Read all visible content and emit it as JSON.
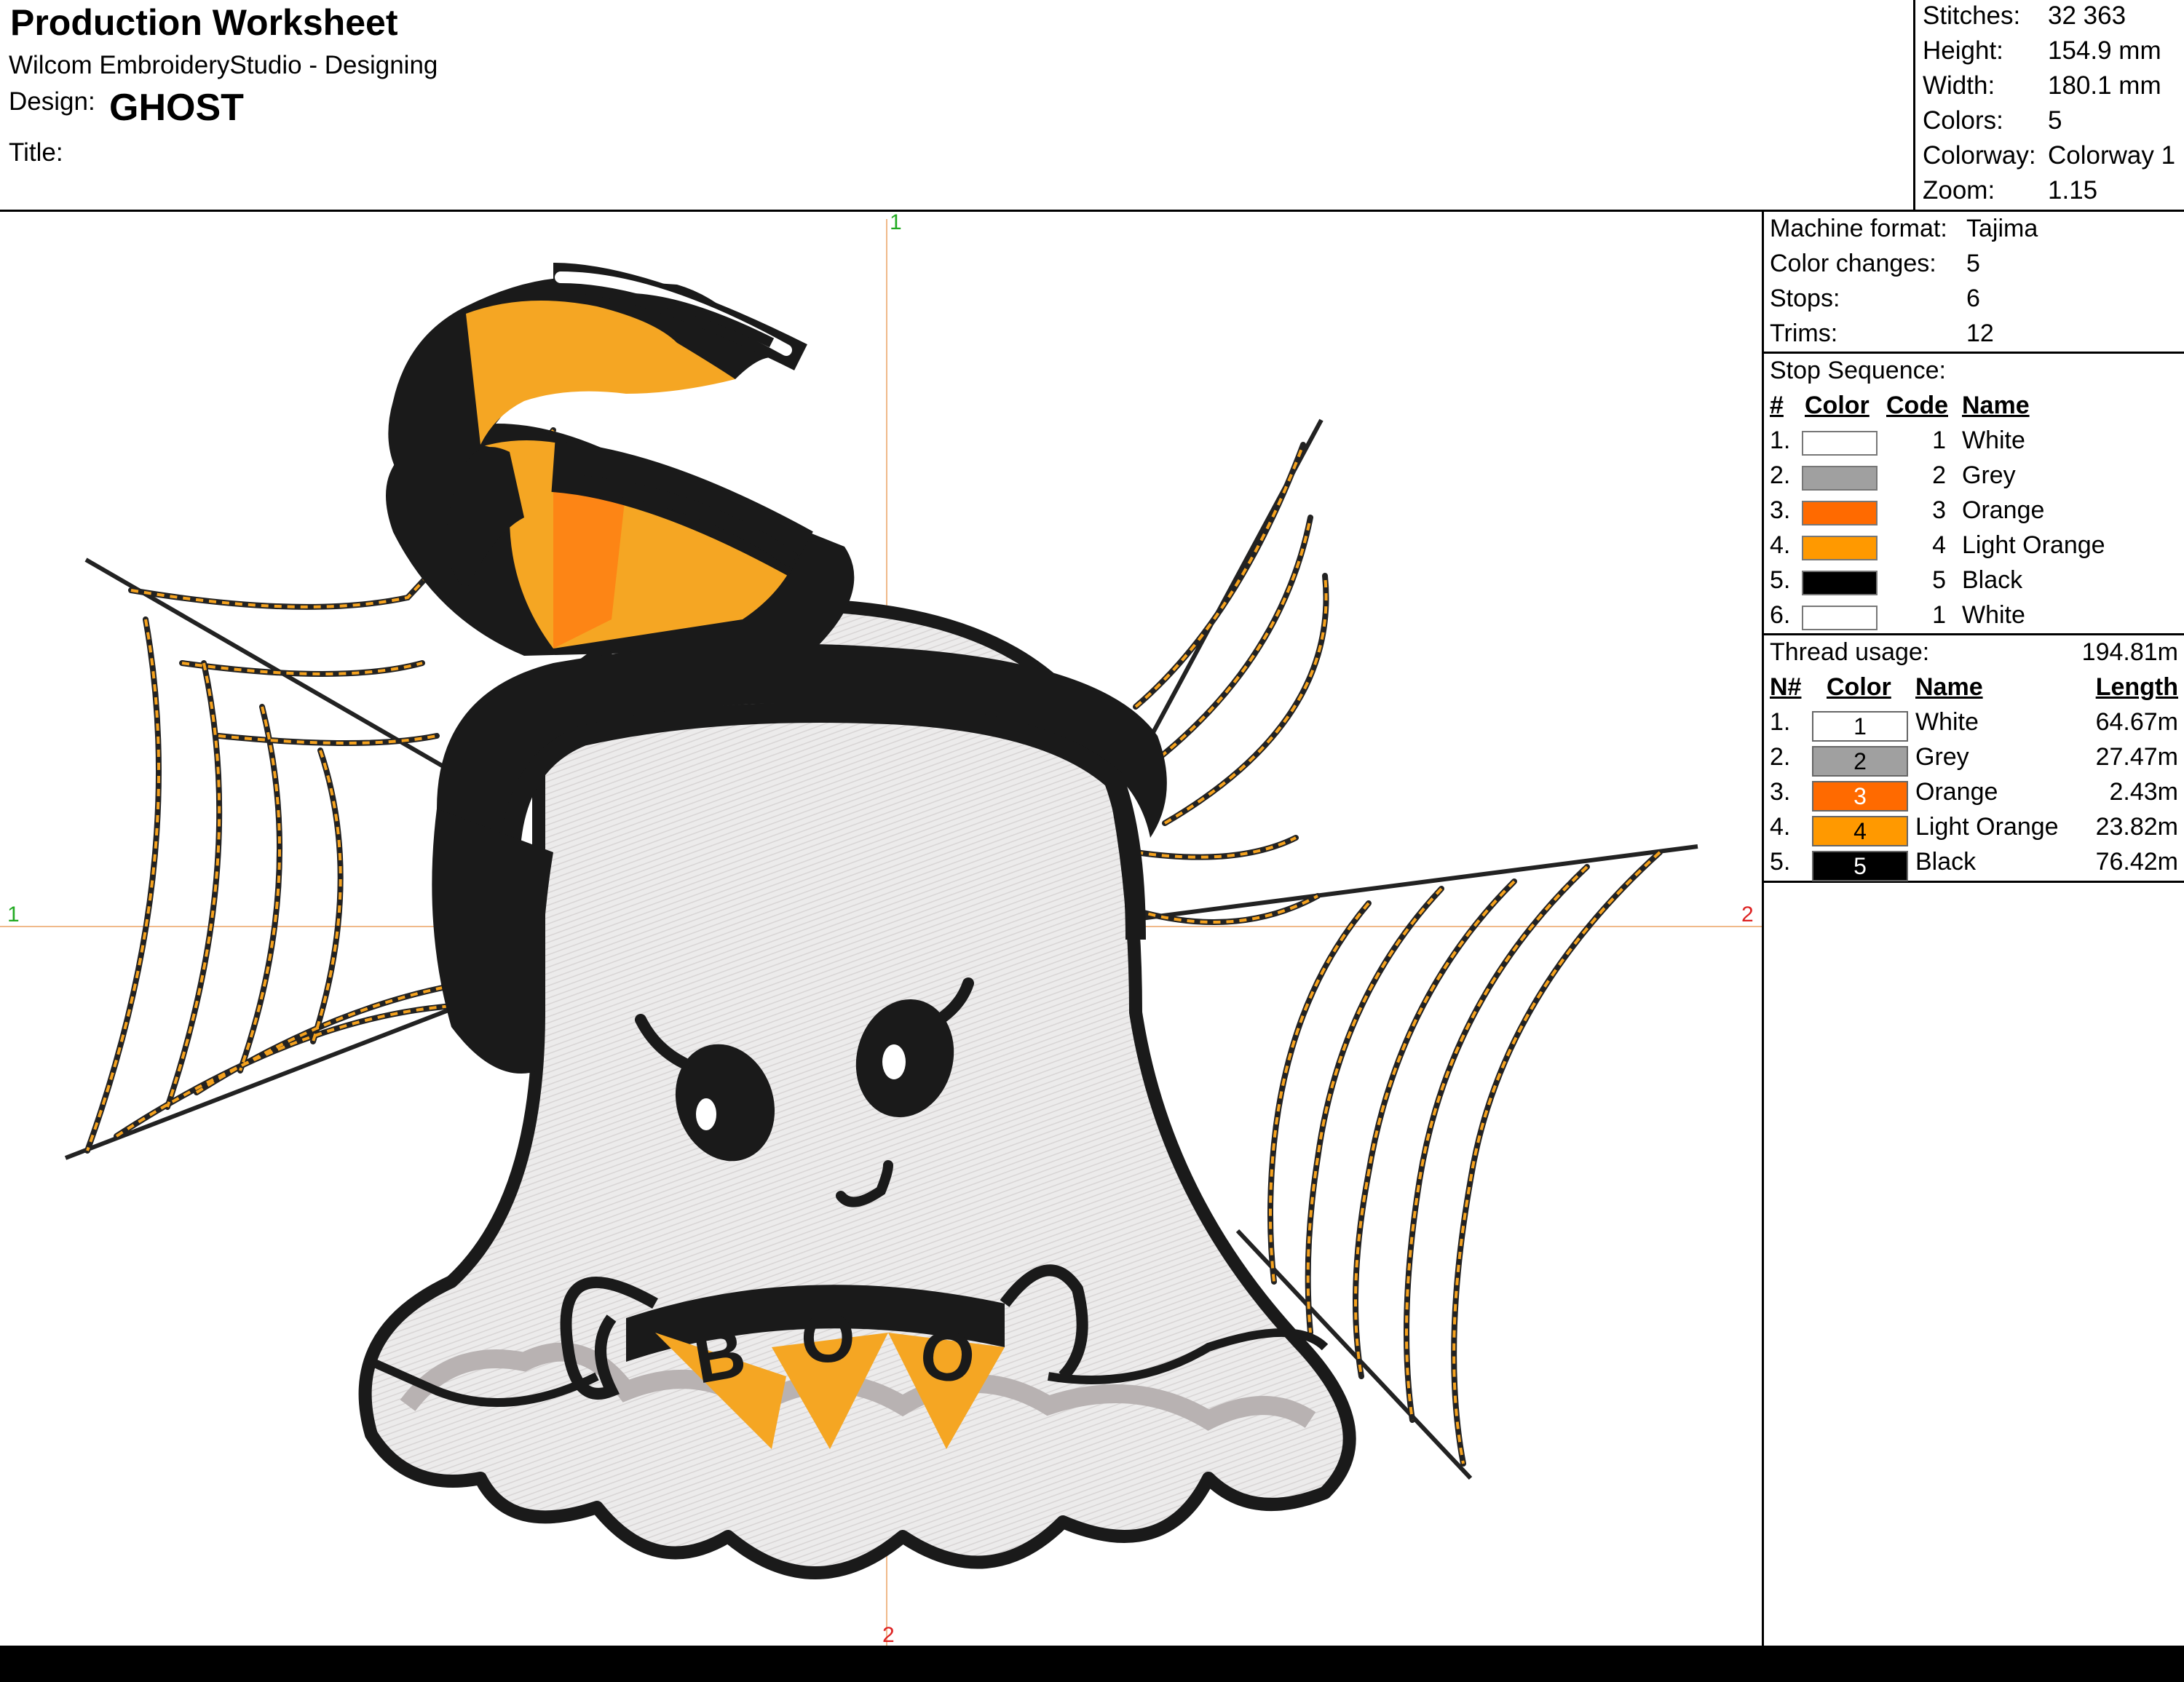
{
  "header": {
    "title": "Production Worksheet",
    "software": "Wilcom EmbroideryStudio - Designing",
    "design_label": "Design:",
    "design_name": "GHOST",
    "title_label": "Title:"
  },
  "stats": [
    {
      "label": "Stitches:",
      "value": "32 363"
    },
    {
      "label": "Height:",
      "value": "154.9 mm"
    },
    {
      "label": "Width:",
      "value": "180.1 mm"
    },
    {
      "label": "Colors:",
      "value": "5"
    },
    {
      "label": "Colorway:",
      "value": "Colorway 1"
    },
    {
      "label": "Zoom:",
      "value": "1.15"
    }
  ],
  "machine": [
    {
      "label": "Machine format:",
      "value": "Tajima"
    },
    {
      "label": "Color changes:",
      "value": "5"
    },
    {
      "label": "Stops:",
      "value": "6"
    },
    {
      "label": "Trims:",
      "value": "12"
    }
  ],
  "stop_sequence": {
    "title": "Stop Sequence:",
    "headers": {
      "num": "#",
      "color": "Color",
      "code": "Code",
      "name": "Name"
    },
    "rows": [
      {
        "num": "1.",
        "color": "#ffffff",
        "code": "1",
        "name": "White"
      },
      {
        "num": "2.",
        "color": "#a0a0a0",
        "code": "2",
        "name": "Grey"
      },
      {
        "num": "3.",
        "color": "#ff6a00",
        "code": "3",
        "name": "Orange"
      },
      {
        "num": "4.",
        "color": "#ff9900",
        "code": "4",
        "name": "Light Orange"
      },
      {
        "num": "5.",
        "color": "#000000",
        "code": "5",
        "name": "Black"
      },
      {
        "num": "6.",
        "color": "#ffffff",
        "code": "1",
        "name": "White"
      }
    ]
  },
  "thread_usage": {
    "title": "Thread usage:",
    "total": "194.81m",
    "headers": {
      "num": "N#",
      "color": "Color",
      "name": "Name",
      "length": "Length"
    },
    "rows": [
      {
        "num": "1.",
        "color": "#ffffff",
        "code": "1",
        "code_color": "#000000",
        "name": "White",
        "length": "64.67m"
      },
      {
        "num": "2.",
        "color": "#a0a0a0",
        "code": "2",
        "code_color": "#000000",
        "name": "Grey",
        "length": "27.47m"
      },
      {
        "num": "3.",
        "color": "#ff6a00",
        "code": "3",
        "code_color": "#ffffff",
        "name": "Orange",
        "length": "2.43m"
      },
      {
        "num": "4.",
        "color": "#ff9900",
        "code": "4",
        "code_color": "#000000",
        "name": "Light Orange",
        "length": "23.82m"
      },
      {
        "num": "5.",
        "color": "#000000",
        "code": "5",
        "code_color": "#ffffff",
        "name": "Black",
        "length": "76.42m"
      }
    ]
  },
  "guides": {
    "top": "1",
    "bottom": "2",
    "left": "1",
    "right": "2"
  },
  "design": {
    "banner_text": [
      "B",
      "O",
      "O"
    ]
  }
}
